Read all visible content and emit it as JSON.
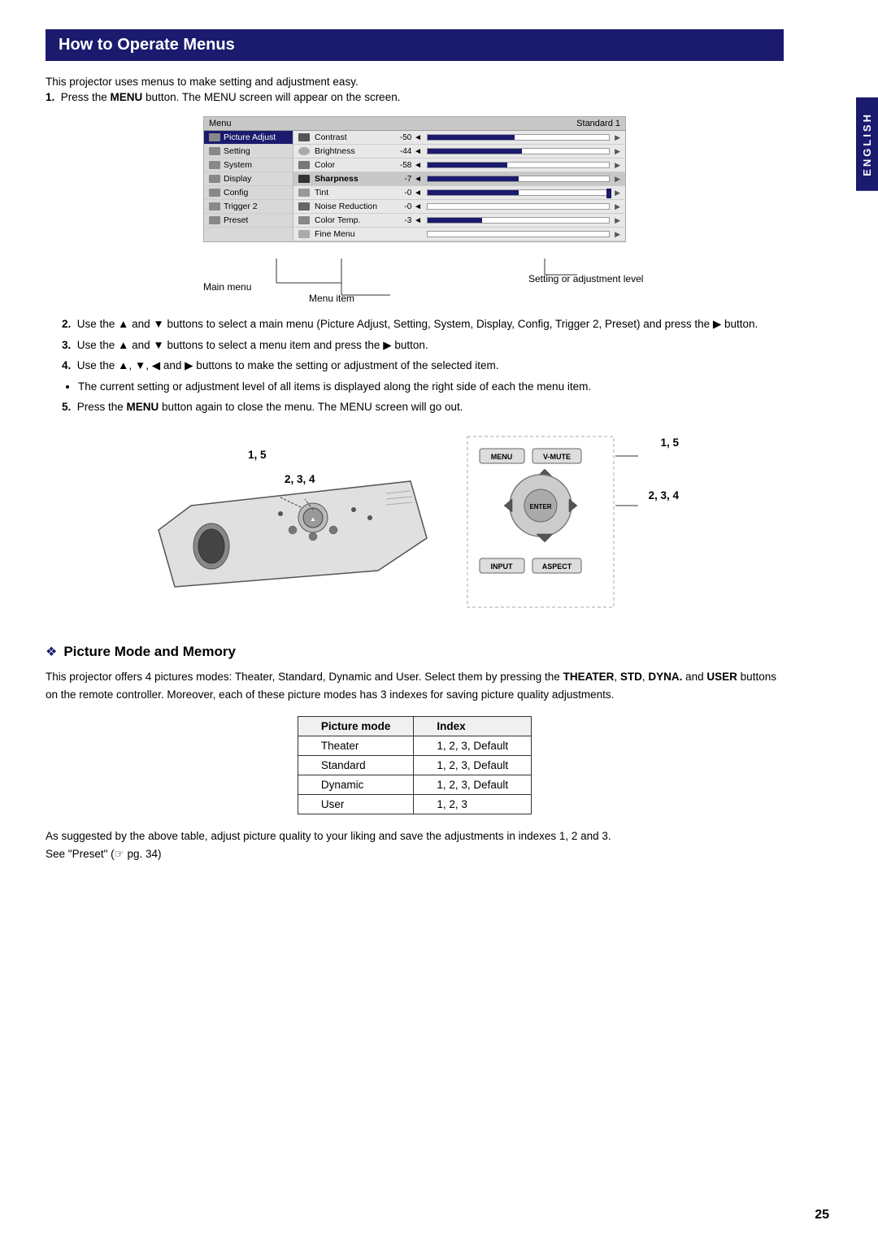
{
  "page": {
    "side_tab": "ENGLISH",
    "page_number": "25"
  },
  "section1": {
    "title": "How to Operate Menus",
    "intro_text": "This projector uses menus to make setting and adjustment easy.",
    "step1": "Press the MENU button. The MENU screen will appear on the screen.",
    "menu_title": "Menu",
    "menu_preset": "Standard 1",
    "menu_left_items": [
      {
        "label": "Picture Adjust",
        "selected": true
      },
      {
        "label": "Setting",
        "selected": false
      },
      {
        "label": "System",
        "selected": false
      },
      {
        "label": "Display",
        "selected": false
      },
      {
        "label": "Config",
        "selected": false
      },
      {
        "label": "Trigger 2",
        "selected": false
      },
      {
        "label": "Preset",
        "selected": false
      }
    ],
    "menu_right_items": [
      {
        "icon": true,
        "name": "Contrast",
        "value": "-50",
        "bar_pct": 48
      },
      {
        "icon": true,
        "name": "Brightness",
        "value": "-44",
        "bar_pct": 52
      },
      {
        "icon": true,
        "name": "Color",
        "value": "-58",
        "bar_pct": 44
      },
      {
        "icon": true,
        "name": "Sharpness",
        "value": "-7",
        "bar_pct": 50,
        "highlight": true
      },
      {
        "icon": true,
        "name": "Tint",
        "value": "-0",
        "bar_pct": 50
      },
      {
        "icon": true,
        "name": "Noise Reduction",
        "value": "-0",
        "bar_pct": 0
      },
      {
        "icon": true,
        "name": "Color Temp.",
        "value": "-3",
        "bar_pct": 30
      },
      {
        "icon": true,
        "name": "Fine Menu",
        "value": "",
        "bar_pct": 0
      }
    ],
    "label_main_menu": "Main menu",
    "label_menu_item": "Menu item",
    "label_setting_level": "Setting or adjustment level"
  },
  "steps": [
    {
      "num": "2.",
      "text": "Use the ▲ and ▼ buttons to select a main menu (Picture Adjust, Setting, System, Display, Config, Trigger 2, Preset) and press the ▶ button."
    },
    {
      "num": "3.",
      "text": "Use the ▲ and ▼ buttons to select a menu item and press the ▶ button."
    },
    {
      "num": "4.",
      "text": "Use the ▲, ▼, ◀ and ▶ buttons to make the setting or adjustment of the selected item."
    },
    {
      "num": "sub",
      "text": "The current setting or adjustment level of all items is displayed along the right side of each the menu item."
    },
    {
      "num": "5.",
      "text": "Press the MENU button again to close the menu. The MENU screen will go out."
    }
  ],
  "diagrams": {
    "left_label_15": "1, 5",
    "left_label_234": "2, 3, 4",
    "right_label_15": "1, 5",
    "right_label_234": "2, 3, 4",
    "remote_buttons": [
      "MENU",
      "V-MUTE",
      "ENTER",
      "INPUT",
      "ASPECT"
    ]
  },
  "section2": {
    "title": "Picture Mode and Memory",
    "diamond": "❖",
    "intro_text": "This projector offers 4 pictures modes: Theater, Standard, Dynamic and User. Select them by pressing the ",
    "bold_parts": [
      "THEATER",
      "STD",
      "DYNA.",
      "USER"
    ],
    "intro_text2": " buttons on the remote controller. Moreover, each of these picture modes has 3 indexes for saving picture quality adjustments.",
    "table": {
      "headers": [
        "Picture mode",
        "Index"
      ],
      "rows": [
        [
          "Theater",
          "1, 2, 3, Default"
        ],
        [
          "Standard",
          "1, 2, 3, Default"
        ],
        [
          "Dynamic",
          "1, 2, 3, Default"
        ],
        [
          "User",
          "1, 2, 3"
        ]
      ]
    },
    "footer_text": "As suggested by the above table, adjust picture quality to your liking and save the adjustments in indexes 1, 2 and 3.",
    "footer_text2": "See \"Preset\" (☞ pg. 34)"
  }
}
